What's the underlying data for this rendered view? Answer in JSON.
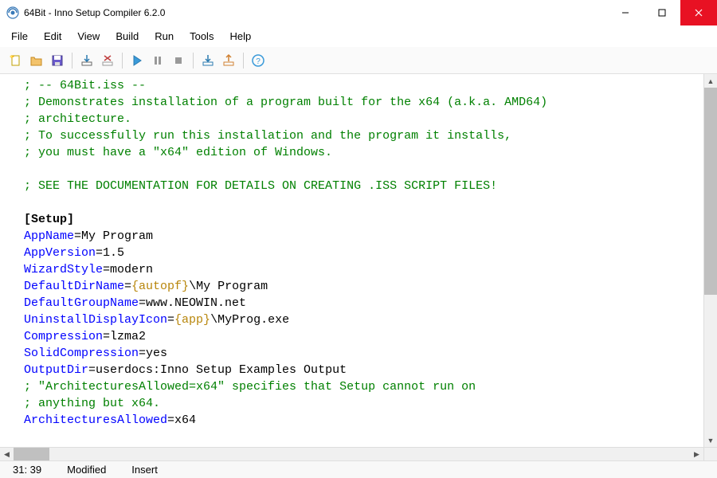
{
  "window": {
    "title": "64Bit - Inno Setup Compiler 6.2.0"
  },
  "menubar": {
    "file": "File",
    "edit": "Edit",
    "view": "View",
    "build": "Build",
    "run": "Run",
    "tools": "Tools",
    "help": "Help"
  },
  "code": {
    "l1": "; -- 64Bit.iss --",
    "l2": "; Demonstrates installation of a program built for the x64 (a.k.a. AMD64)",
    "l3": "; architecture.",
    "l4": "; To successfully run this installation and the program it installs,",
    "l5": "; you must have a \"x64\" edition of Windows.",
    "l6": "; SEE THE DOCUMENTATION FOR DETAILS ON CREATING .ISS SCRIPT FILES!",
    "section": "[Setup]",
    "k_appname": "AppName",
    "v_appname": "=My Program",
    "k_appver": "AppVersion",
    "v_appver": "=1.5",
    "k_wiz": "WizardStyle",
    "v_wiz": "=modern",
    "k_defdir": "DefaultDirName",
    "v_defdir_eq": "=",
    "v_defdir_c": "{autopf}",
    "v_defdir_r": "\\My Program",
    "k_defgrp": "DefaultGroupName",
    "v_defgrp": "=www.NEOWIN.net",
    "k_uninst": "UninstallDisplayIcon",
    "v_uninst_eq": "=",
    "v_uninst_c": "{app}",
    "v_uninst_r": "\\MyProg.exe",
    "k_comp": "Compression",
    "v_comp": "=lzma2",
    "k_solid": "SolidCompression",
    "v_solid": "=yes",
    "k_outdir": "OutputDir",
    "v_outdir": "=userdocs:Inno Setup Examples Output",
    "c_arch1": "; \"ArchitecturesAllowed=x64\" specifies that Setup cannot run on",
    "c_arch2": "; anything but x64.",
    "k_arch": "ArchitecturesAllowed",
    "v_arch": "=x64"
  },
  "statusbar": {
    "pos": "  31:  39",
    "modified": "Modified",
    "insert": "Insert"
  }
}
